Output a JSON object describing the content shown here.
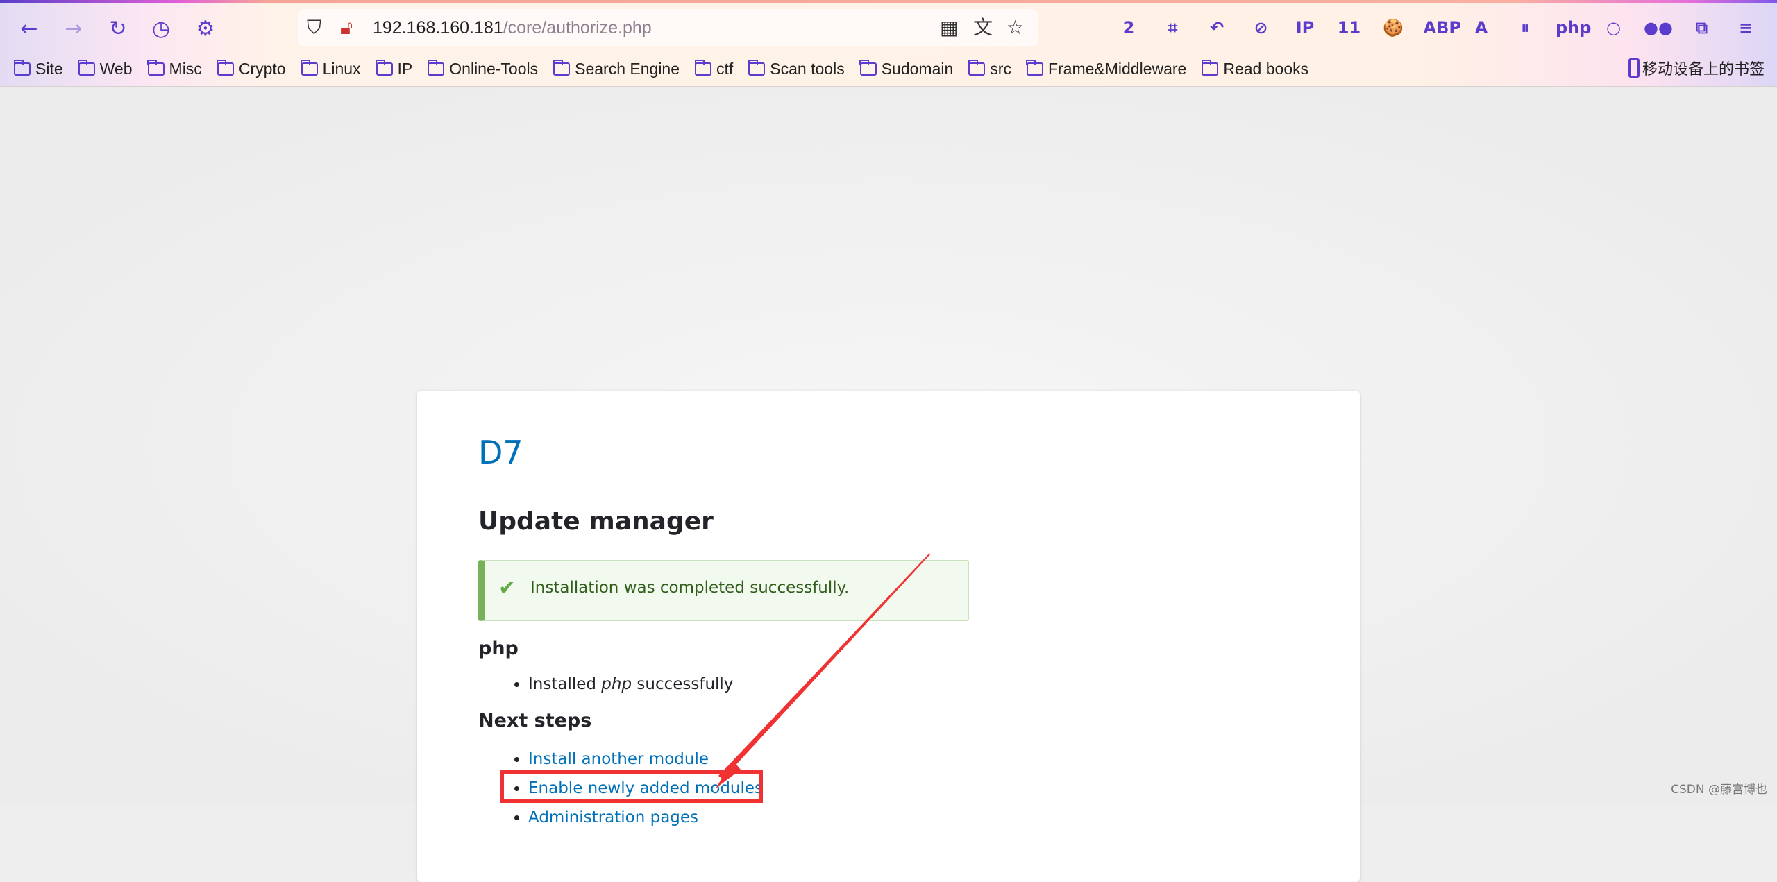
{
  "browser": {
    "url_host": "192.168.160.181",
    "url_path": "/core/authorize.php",
    "nav": [
      "back-icon",
      "forward-icon",
      "reload-icon",
      "history-icon",
      "settings-icon"
    ],
    "extensions": [
      {
        "name": "badge-2-extension",
        "label": "2"
      },
      {
        "name": "crop-extension",
        "label": "⌗"
      },
      {
        "name": "undo-extension",
        "label": "↶"
      },
      {
        "name": "no-cookie-extension",
        "label": "⊘"
      },
      {
        "name": "ip-extension",
        "label": "IP"
      },
      {
        "name": "download-extension",
        "label": "11"
      },
      {
        "name": "cookie-extension",
        "label": "🍪"
      },
      {
        "name": "adblock-extension",
        "label": "ABP"
      },
      {
        "name": "translate-extension",
        "label": "A"
      },
      {
        "name": "paused-extension",
        "label": "⏸"
      },
      {
        "name": "php-extension",
        "label": "php"
      },
      {
        "name": "circle-extension",
        "label": "○"
      },
      {
        "name": "glasses-extension",
        "label": "●●"
      },
      {
        "name": "extensions-puzzle",
        "label": "⧉"
      },
      {
        "name": "menu",
        "label": "≡"
      }
    ],
    "bookmarks": [
      "Site",
      "Web",
      "Misc",
      "Crypto",
      "Linux",
      "IP",
      "Online-Tools",
      "Search Engine",
      "ctf",
      "Scan tools",
      "Sudomain",
      "src",
      "Frame&Middleware",
      "Read books"
    ],
    "mobile_bookmarks": "移动设备上的书签"
  },
  "page": {
    "site_name": "D7",
    "title": "Update manager",
    "status_message": "Installation was completed successfully.",
    "project_heading": "php",
    "result_prefix": "Installed ",
    "result_project": "php",
    "result_suffix": " successfully",
    "next_steps_heading": "Next steps",
    "links": [
      "Install another module",
      "Enable newly added modules",
      "Administration pages"
    ],
    "annotation_color": "#f03232"
  },
  "watermark": "CSDN @藤宫博也"
}
